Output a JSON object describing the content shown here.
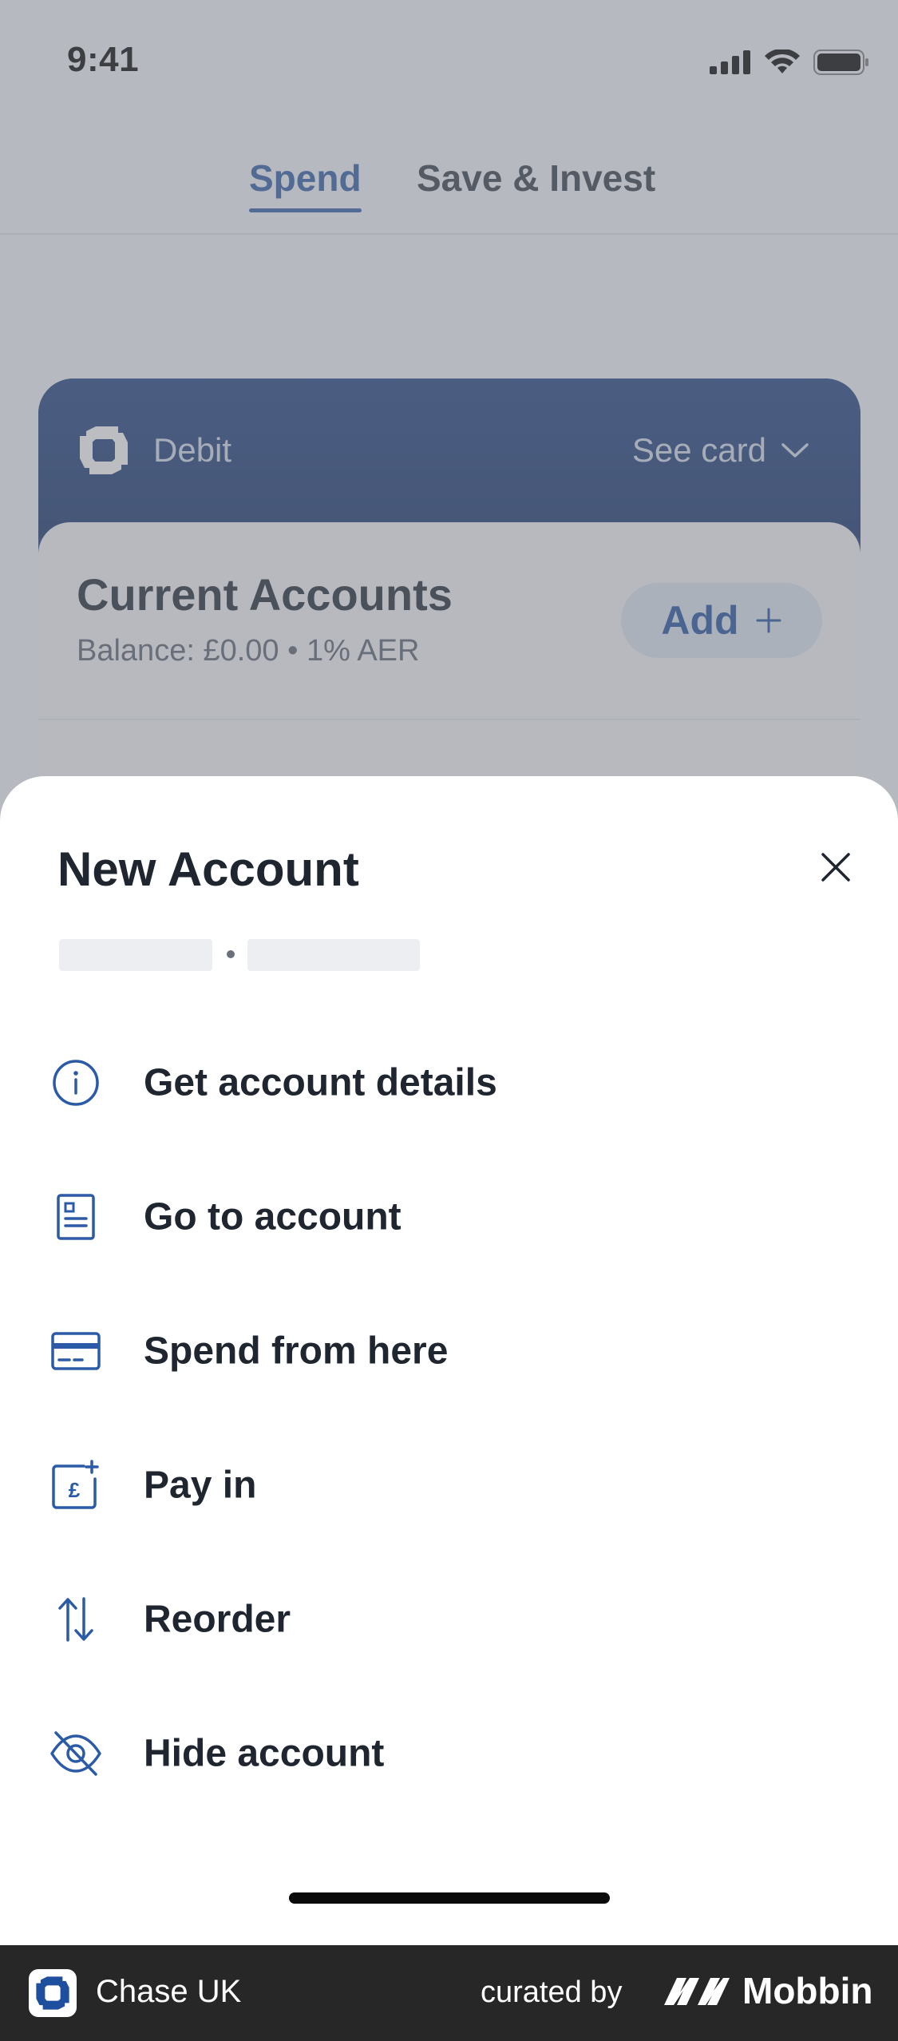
{
  "status_bar": {
    "time": "9:41"
  },
  "tabs": [
    {
      "label": "Spend",
      "active": true
    },
    {
      "label": "Save & Invest",
      "active": false
    }
  ],
  "card": {
    "type_label": "Debit",
    "see_card_label": "See card",
    "accounts_title": "Current Accounts",
    "balance_text": "Balance: £0.00 • 1% AER",
    "add_label": "Add",
    "add_icon": "plus-icon"
  },
  "sheet": {
    "title": "New Account",
    "close_icon": "close-icon",
    "items": [
      {
        "label": "Get account details",
        "icon": "info-icon"
      },
      {
        "label": "Go to account",
        "icon": "document-icon"
      },
      {
        "label": "Spend from here",
        "icon": "card-icon"
      },
      {
        "label": "Pay in",
        "icon": "pay-in-icon"
      },
      {
        "label": "Reorder",
        "icon": "reorder-icon"
      },
      {
        "label": "Hide account",
        "icon": "eye-off-icon"
      }
    ]
  },
  "footer": {
    "app_name": "Chase UK",
    "curated_by": "curated by",
    "brand": "Mobbin"
  },
  "colors": {
    "accent": "#2b5aa6",
    "card_navy": "#1a3c7d",
    "icon_blue": "#2b5aa6",
    "text_dark": "#1f2630"
  }
}
